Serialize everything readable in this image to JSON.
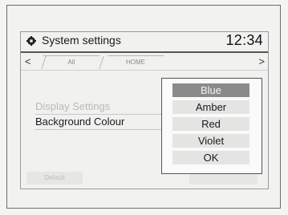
{
  "header": {
    "title": "System settings",
    "icon": "gear-icon",
    "time": "12:34"
  },
  "tabs": [
    {
      "label": "All"
    },
    {
      "label": "HOME"
    }
  ],
  "menu": {
    "items": [
      {
        "label": "Display Settings",
        "enabled": false
      },
      {
        "label": "Background Colour",
        "enabled": true
      }
    ]
  },
  "footer": {
    "default_label": "Default"
  },
  "popup": {
    "options": [
      {
        "label": "Blue",
        "selected": true
      },
      {
        "label": "Amber",
        "selected": false
      },
      {
        "label": "Red",
        "selected": false
      },
      {
        "label": "Violet",
        "selected": false
      },
      {
        "label": "OK",
        "selected": false
      }
    ]
  }
}
